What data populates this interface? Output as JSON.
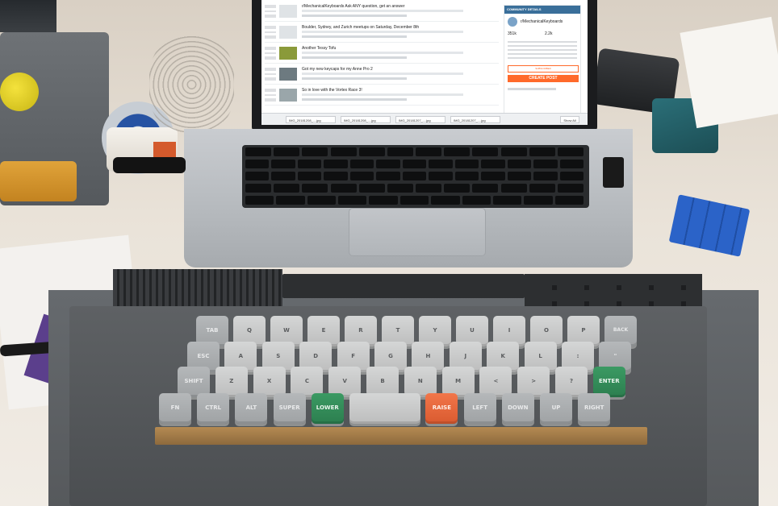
{
  "screen": {
    "posts": [
      {
        "title": "r/MechanicalKeyboards Ask ANY question, get an answer"
      },
      {
        "title": "Boulder, Sydney, and Zurich meetups on Saturday, December 8th"
      },
      {
        "title": "Another Tessy Tofu"
      },
      {
        "title": "Got my new keycaps for my Anne Pro 2"
      },
      {
        "title": "So in love with the Vortex Race 3!"
      }
    ],
    "sidebar": {
      "header": "COMMUNITY DETAILS",
      "community_name": "r/MechanicalKeyboards",
      "subscribers": "351k",
      "online": "2.2k",
      "subscribe_label": "SUBSCRIBED",
      "create_post_label": "CREATE POST"
    },
    "downloads": [
      {
        "label": "IMG_20181208_....jpg"
      },
      {
        "label": "IMG_20181208_....jpg"
      },
      {
        "label": "IMG_20181207_....jpg"
      },
      {
        "label": "IMG_20181207_....jpg"
      }
    ],
    "show_all_label": "Show All"
  },
  "keyboard": {
    "rows": [
      {
        "keys": [
          {
            "label": "TAB",
            "style": "grey"
          },
          {
            "label": "Q",
            "style": "light"
          },
          {
            "label": "W",
            "style": "light"
          },
          {
            "label": "E",
            "style": "light"
          },
          {
            "label": "R",
            "style": "light"
          },
          {
            "label": "T",
            "style": "light"
          },
          {
            "label": "Y",
            "style": "light"
          },
          {
            "label": "U",
            "style": "light"
          },
          {
            "label": "I",
            "style": "light"
          },
          {
            "label": "O",
            "style": "light"
          },
          {
            "label": "P",
            "style": "light"
          },
          {
            "label": "BACK SPACE",
            "style": "grey"
          }
        ]
      },
      {
        "keys": [
          {
            "label": "ESC",
            "style": "grey"
          },
          {
            "label": "A",
            "style": "light"
          },
          {
            "label": "S",
            "style": "light"
          },
          {
            "label": "D",
            "style": "light"
          },
          {
            "label": "F",
            "style": "light"
          },
          {
            "label": "G",
            "style": "light"
          },
          {
            "label": "H",
            "style": "light"
          },
          {
            "label": "J",
            "style": "light"
          },
          {
            "label": "K",
            "style": "light"
          },
          {
            "label": "L",
            "style": "light"
          },
          {
            "label": ":",
            "style": "light"
          },
          {
            "label": "\"",
            "style": "grey"
          }
        ]
      },
      {
        "keys": [
          {
            "label": "SHIFT",
            "style": "grey"
          },
          {
            "label": "Z",
            "style": "light"
          },
          {
            "label": "X",
            "style": "light"
          },
          {
            "label": "C",
            "style": "light"
          },
          {
            "label": "V",
            "style": "light"
          },
          {
            "label": "B",
            "style": "light"
          },
          {
            "label": "N",
            "style": "light"
          },
          {
            "label": "M",
            "style": "light"
          },
          {
            "label": "<",
            "style": "light"
          },
          {
            "label": ">",
            "style": "light"
          },
          {
            "label": "?",
            "style": "light"
          },
          {
            "label": "ENTER",
            "style": "green"
          }
        ]
      },
      {
        "keys": [
          {
            "label": "FN",
            "style": "grey"
          },
          {
            "label": "CTRL",
            "style": "grey"
          },
          {
            "label": "ALT",
            "style": "grey"
          },
          {
            "label": "SUPER",
            "style": "grey"
          },
          {
            "label": "LOWER",
            "style": "green"
          },
          {
            "label": "",
            "style": "light",
            "span": 2
          },
          {
            "label": "RAISE",
            "style": "orange"
          },
          {
            "label": "LEFT",
            "style": "grey"
          },
          {
            "label": "DOWN",
            "style": "grey"
          },
          {
            "label": "UP",
            "style": "grey"
          },
          {
            "label": "RIGHT",
            "style": "grey"
          }
        ]
      }
    ],
    "colors": {
      "accent_green": "#2c7e4f",
      "accent_orange": "#d95a2f",
      "keycap_light": "#d5d6d6",
      "keycap_grey": "#a8abad"
    }
  }
}
